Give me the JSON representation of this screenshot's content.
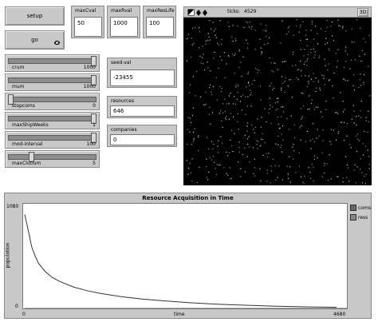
{
  "buttons": {
    "setup_label": "setup",
    "go_label": "go"
  },
  "inputs": {
    "max_cval": {
      "label": "maxCval",
      "value": "50"
    },
    "max_rval": {
      "label": "maxRval",
      "value": "1000"
    },
    "max_res_life": {
      "label": "maxResLife",
      "value": "100"
    },
    "seed_val": {
      "label": "seed-val",
      "value": "-23455"
    }
  },
  "sliders": [
    {
      "label": "crum",
      "value": "1000",
      "fraction": 1.0
    },
    {
      "label": "mum",
      "value": "1000",
      "fraction": 1.0
    },
    {
      "label": "stopcoms",
      "value": "0",
      "fraction": 0.0
    },
    {
      "label": "maxShipWeeks",
      "value": "1",
      "fraction": 1.0
    },
    {
      "label": "mod-interval",
      "value": "100",
      "fraction": 1.0
    },
    {
      "label": "maxClutium",
      "value": "5",
      "fraction": 0.25
    }
  ],
  "monitors": {
    "resources": {
      "label": "resources",
      "value": "646"
    },
    "companies": {
      "label": "companies",
      "value": "0"
    }
  },
  "view": {
    "ticks_label": "ticks:",
    "ticks_value": "4529",
    "speed_label": "3D"
  },
  "plot": {
    "title": "Resource Acquisition in Time",
    "ylabel": "population",
    "xlabel": "time",
    "ymax_label": "1080",
    "ymin_label": "0",
    "xmin_label": "0",
    "xmax_label": "4680",
    "legend": [
      {
        "name": "coms",
        "color": "#666666"
      },
      {
        "name": "ress",
        "color": "#888888"
      }
    ]
  },
  "chart_data": {
    "type": "line",
    "title": "Resource Acquisition in Time",
    "xlabel": "time",
    "ylabel": "population",
    "xlim": [
      0,
      4680
    ],
    "ylim": [
      0,
      1080
    ],
    "series": [
      {
        "name": "coms",
        "x": [
          0,
          4680
        ],
        "y": [
          0,
          0
        ]
      },
      {
        "name": "ress",
        "x": [
          0,
          30,
          60,
          100,
          150,
          200,
          300,
          400,
          500,
          700,
          900,
          1100,
          1400,
          1700,
          2000,
          2400,
          2800,
          3200,
          3600,
          4000,
          4529
        ],
        "y": [
          1000,
          900,
          800,
          660,
          560,
          480,
          390,
          330,
          290,
          230,
          190,
          160,
          125,
          100,
          82,
          60,
          45,
          34,
          25,
          18,
          12
        ]
      }
    ]
  }
}
